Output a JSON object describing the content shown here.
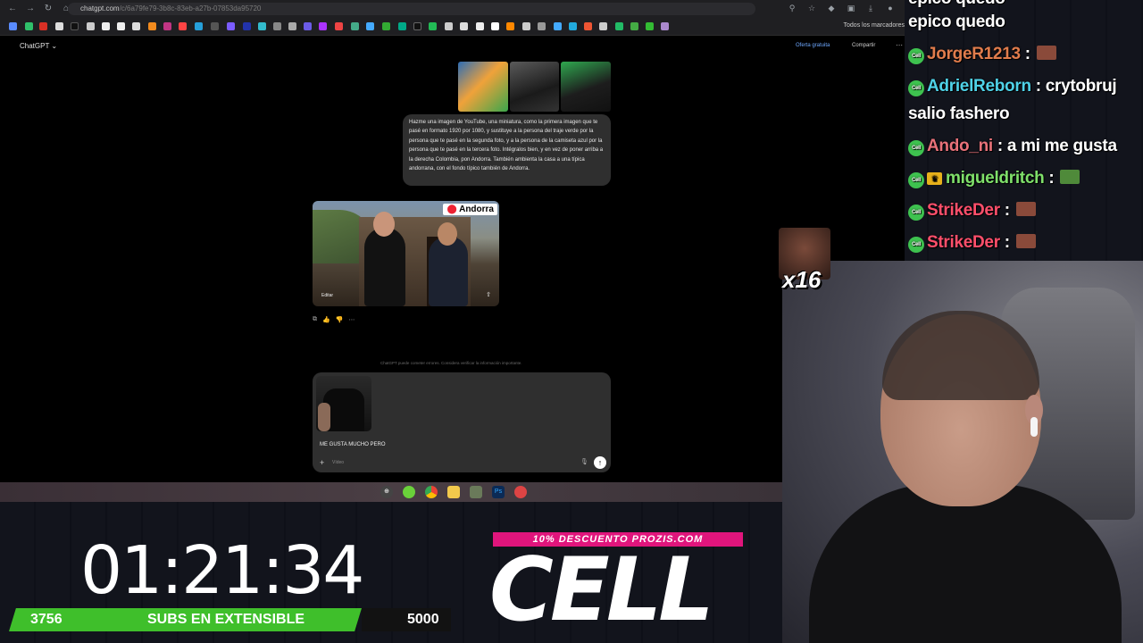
{
  "browser": {
    "url_domain": "chatgpt.com",
    "url_path": "/c/6a79fe79-3b8c-83eb-a27b-07853da95720",
    "all_bookmarks": "Todos los marcadores"
  },
  "chatgpt": {
    "model_label": "ChatGPT ⌄",
    "offer_label": "Oferta gratuita",
    "share_label": "Compartir",
    "prompt_text": "Hazme una imagen de YouTube, una miniatura, como la primera imagen que te pasé en formato 1920 por 1080, y sustituye a la persona del traje verde por la persona que te pasé en la segunda foto, y a la persona de la camiseta azul por la persona que te pasé en la tercera foto. Intégralos bien, y en vez de poner arriba a la derecha Colombia, pon Andorra. También ambienta la casa a una típica andorrana, con el fondo típico también de Andorra.",
    "image_tag": "Andorra",
    "image_edit_label": "Editar",
    "disclaimer": "ChatGPT puede cometer errores. Considera verificar la información importante.",
    "composer_text": "ME GUSTA MUCHO PERO",
    "composer_tool": "Vídeo"
  },
  "chat": {
    "messages": [
      {
        "user": "",
        "text": "épico quedo",
        "user_color": "#2ecc71"
      },
      {
        "user": "JorgeR1213",
        "text": "",
        "user_color": "#e07c4c"
      },
      {
        "user": "AdrielReborn",
        "text": "crytobruj",
        "user_color": "#4fd2e8"
      },
      {
        "user": "",
        "text": "salio fashero",
        "user_color": "#ffffff"
      },
      {
        "user": "Ando_ni",
        "text": "a mi me gusta",
        "user_color": "#e9727a"
      },
      {
        "user": "migueldritch",
        "text": "",
        "user_color": "#7fe06a"
      },
      {
        "user": "StrikeDer",
        "text": "",
        "user_color": "#ff4f6b"
      },
      {
        "user": "StrikeDer",
        "text": "",
        "user_color": "#ff4f6b"
      }
    ],
    "badge_label": "Cell"
  },
  "overlay": {
    "emote_multiplier": "x16",
    "timer": "01:21:34",
    "subs_current": "3756",
    "subs_label": "SUBS EN EXTENSIBLE",
    "subs_goal": "5000",
    "subs_progress": 0.75,
    "promo": "10% DESCUENTO PROZIS.COM",
    "brand": "CELL"
  }
}
